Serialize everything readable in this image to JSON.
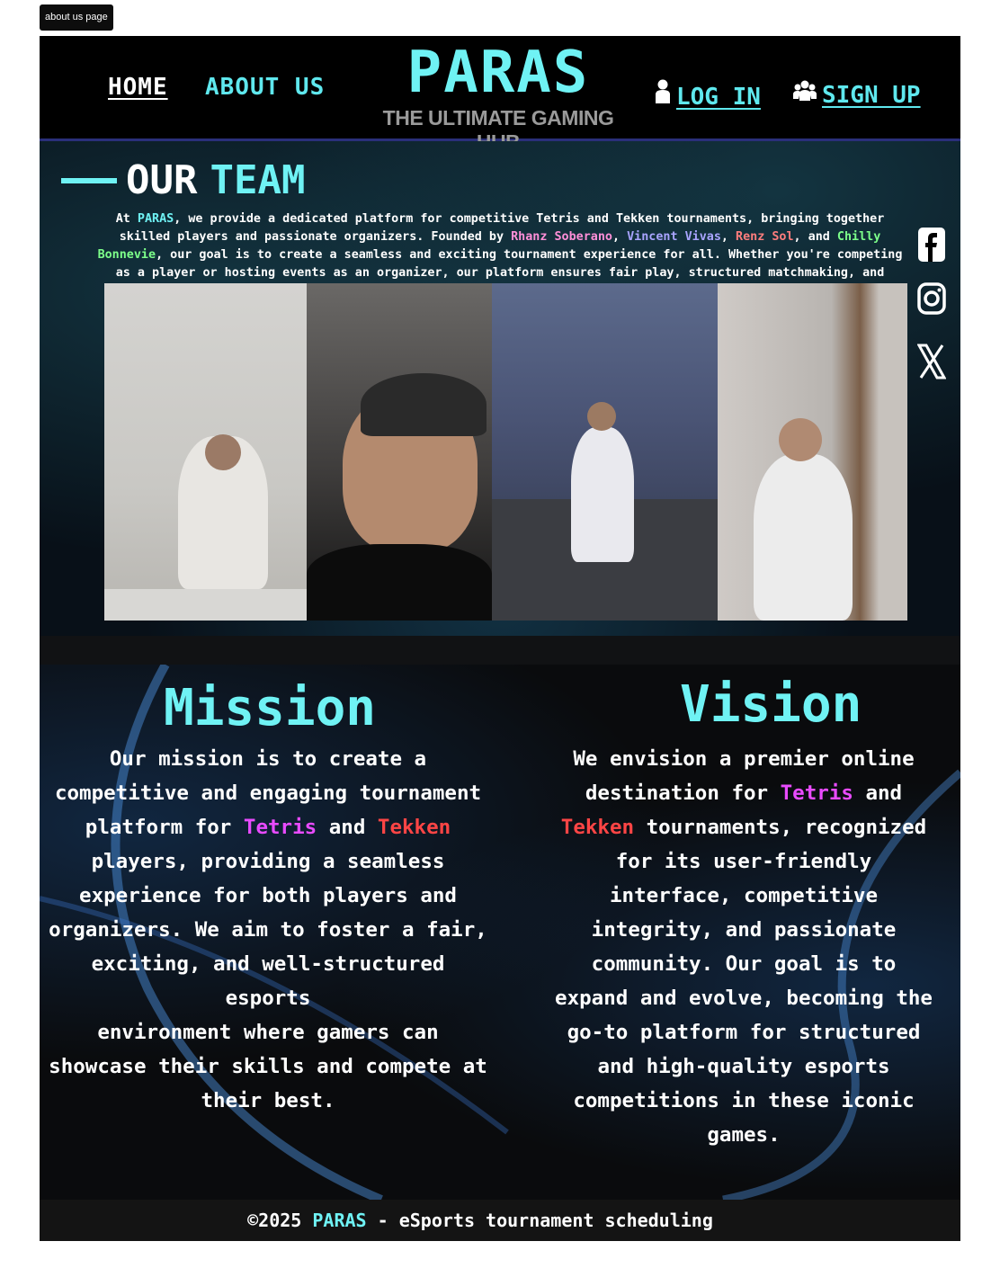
{
  "tab_label": "about us page",
  "nav": {
    "home": "HOME",
    "about": "ABOUT US"
  },
  "brand": {
    "title": "PARAS",
    "subtitle": "THE ULTIMATE GAMING HUB"
  },
  "auth": {
    "login": "LOG IN",
    "signup": "SIGN UP"
  },
  "team": {
    "heading_1": "OUR",
    "heading_2": "TEAM",
    "desc_at": "At ",
    "desc_brand": "PARAS",
    "desc_1": ", we provide a dedicated platform for competitive Tetris and Tekken tournaments, bringing together skilled players and passionate organizers. Founded by ",
    "founder_1": "Rhanz Soberano",
    "sep_1": ", ",
    "founder_2": "Vincent Vivas",
    "sep_2": ", ",
    "founder_3": "Renz Sol",
    "sep_3": ", and ",
    "founder_4": "Chilly Bonnevie",
    "desc_2": ", our goal is to create a seamless and exciting tournament experience for all. Whether you're competing as a player or hosting events as an organizer, our platform ensures fair play, structured matchmaking, and smooth tournament management."
  },
  "social": {
    "facebook": "f",
    "instagram": "◎",
    "x": "𝕏"
  },
  "mission": {
    "title": "Mission",
    "text_1": "Our mission is to create a competitive and engaging tournament platform for ",
    "tetris": "Tetris",
    "and": " and ",
    "tekken": "Tekken",
    "text_2": " players, providing a seamless experience for both players and organizers. We aim to foster a fair, exciting, and well-structured esports",
    "text_3": "environment where gamers can showcase their skills and compete at their best."
  },
  "vision": {
    "title": "Vision",
    "text_1": "We envision a premier online destination for ",
    "tetris": "Tetris",
    "and": " and ",
    "tekken": "Tekken",
    "text_2": " tournaments, recognized for its user-friendly interface, competitive integrity, and passionate community. Our goal is to expand and evolve, becoming the go-to platform for structured and high-quality esports competitions in these iconic games."
  },
  "footer": {
    "prefix": "©2025 ",
    "brand": "PARAS",
    "suffix": " - eSports tournament scheduling"
  },
  "colors": {
    "accent": "#6ff2f4",
    "tetris": "#e94bff",
    "tekken": "#ff4545"
  }
}
